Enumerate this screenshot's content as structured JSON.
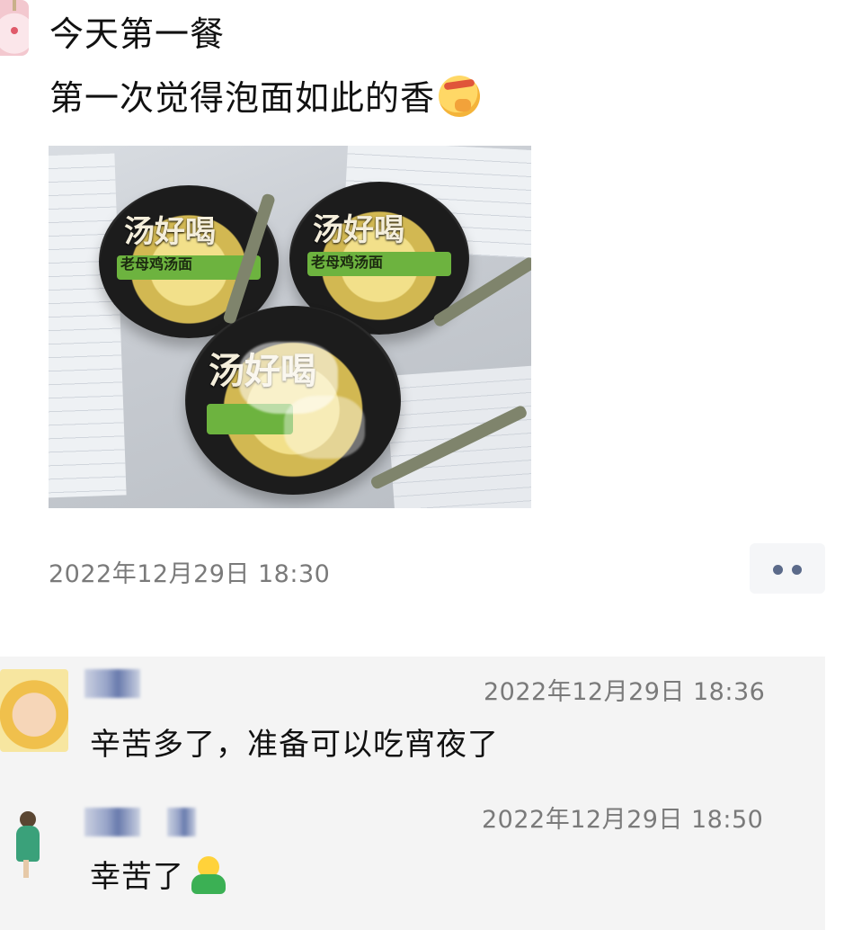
{
  "post": {
    "line1": "今天第一餐",
    "line2": "第一次觉得泡面如此的香",
    "emoji": "face-with-headband-emoji",
    "photo_text": {
      "brand": "汤好喝",
      "flavor": "老母鸡汤面"
    },
    "timestamp": "2022年12月29日 18:30",
    "more_icon": "more-dots-icon"
  },
  "comments": [
    {
      "timestamp": "2022年12月29日 18:36",
      "text": "辛苦多了，准备可以吃宵夜了"
    },
    {
      "timestamp": "2022年12月29日 18:50",
      "text": "幸苦了",
      "emoji": "green-person-emoji"
    }
  ],
  "colors": {
    "comment_bg": "#f4f4f4",
    "meta_text": "#7a7a7a",
    "more_dots": "#5b6a8a"
  }
}
